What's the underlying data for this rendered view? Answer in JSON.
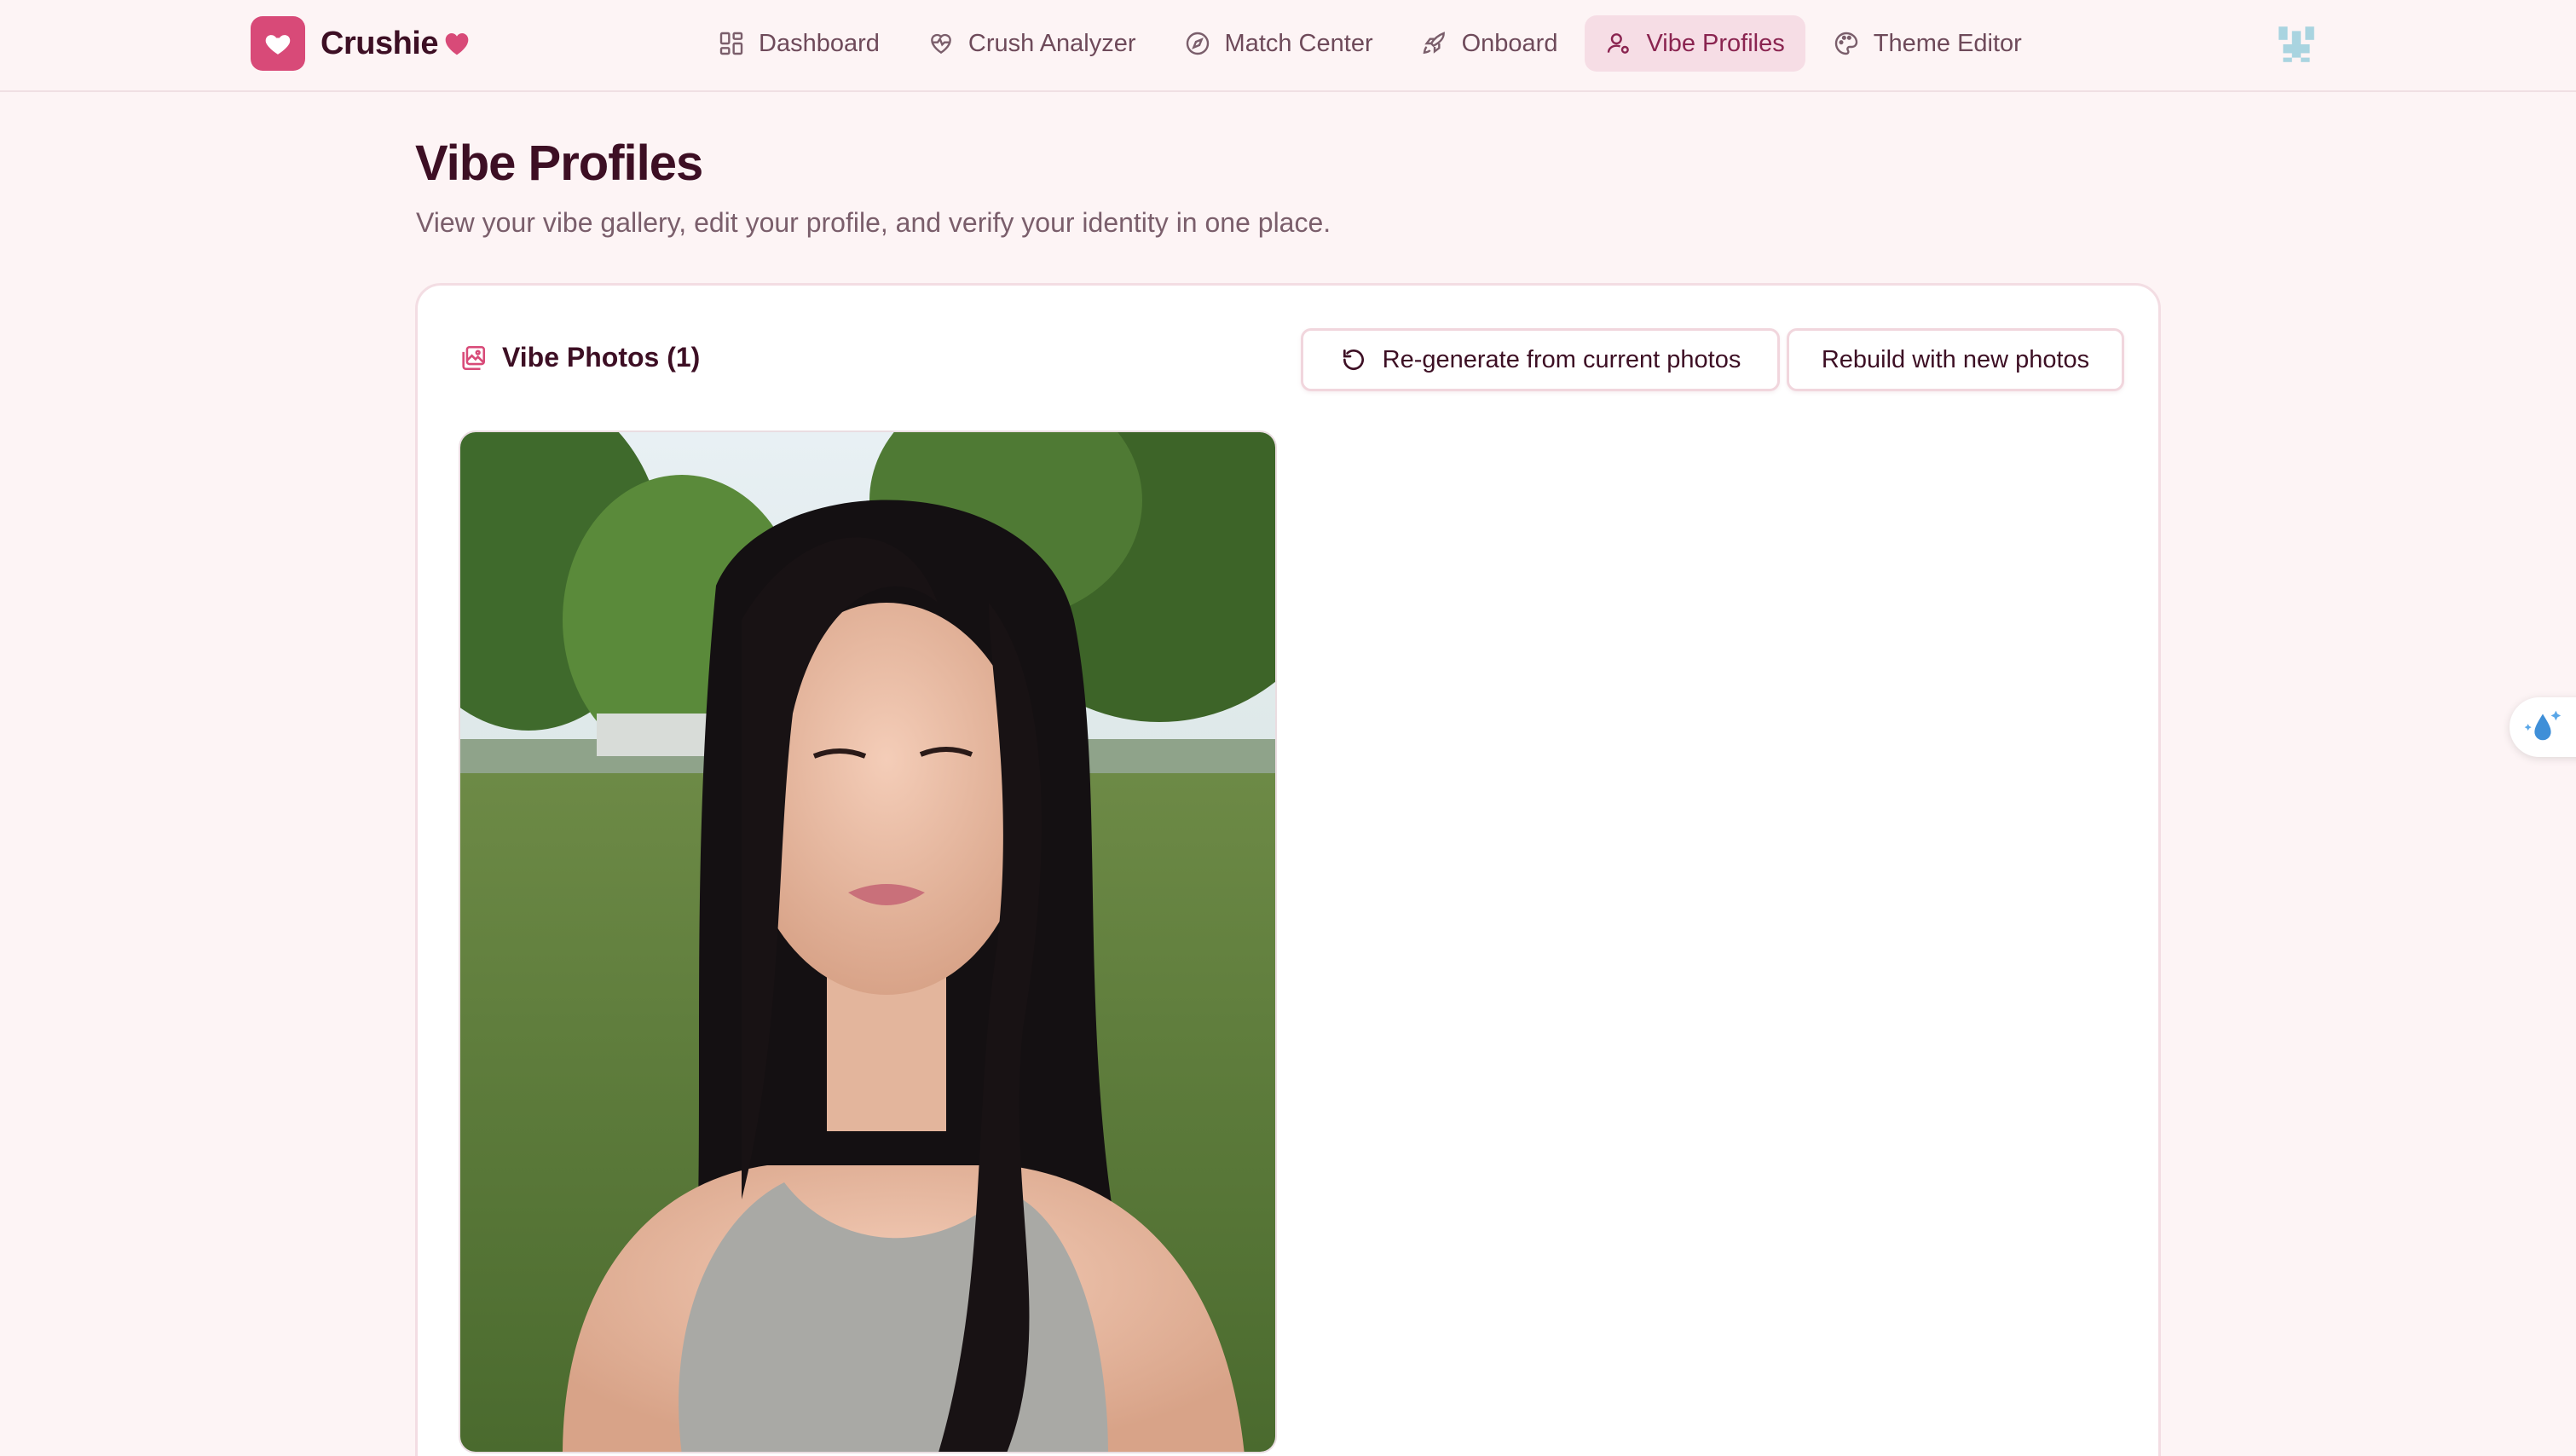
{
  "brand": {
    "name": "Crushie"
  },
  "nav": {
    "items": [
      {
        "label": "Dashboard",
        "icon": "grid-icon"
      },
      {
        "label": "Crush Analyzer",
        "icon": "heart-pulse-icon"
      },
      {
        "label": "Match Center",
        "icon": "compass-icon"
      },
      {
        "label": "Onboard",
        "icon": "rocket-icon"
      },
      {
        "label": "Vibe Profiles",
        "icon": "user-icon",
        "active": true
      },
      {
        "label": "Theme Editor",
        "icon": "palette-icon"
      }
    ]
  },
  "page": {
    "title": "Vibe Profiles",
    "subtitle": "View your vibe gallery, edit your profile, and verify your identity in one place."
  },
  "gallery": {
    "title": "Vibe Photos (1)",
    "regenerate_label": "Re-generate from current photos",
    "rebuild_label": "Rebuild with new photos"
  },
  "colors": {
    "accent": "#d84a78",
    "active_nav_bg": "#f6dde5",
    "page_bg": "#fdf4f5",
    "heading": "#3d0f24"
  }
}
